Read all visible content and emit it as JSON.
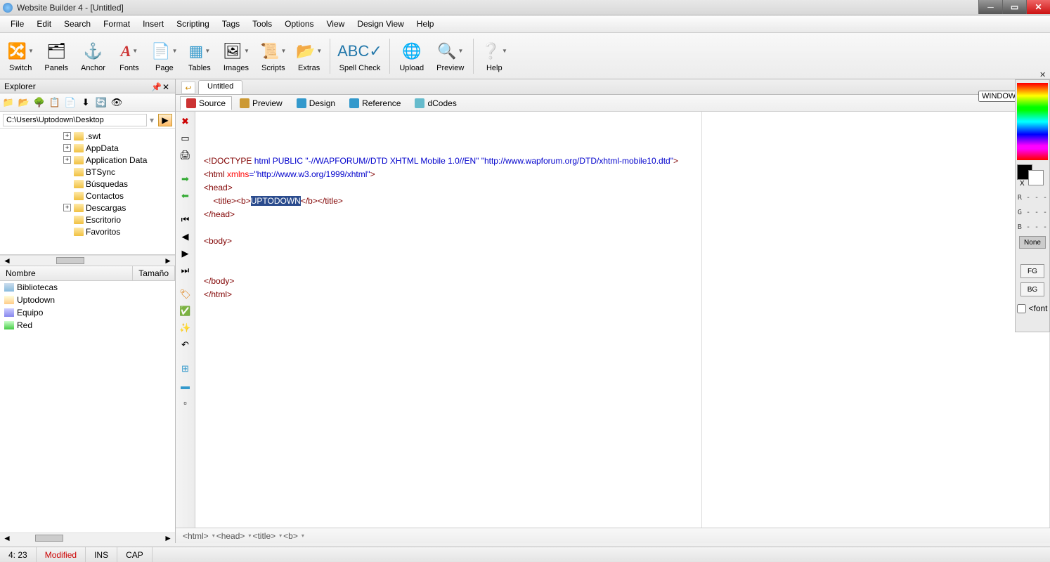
{
  "titlebar": {
    "title": "Website Builder 4 - [Untitled]"
  },
  "menu": {
    "items": [
      "File",
      "Edit",
      "Search",
      "Format",
      "Insert",
      "Scripting",
      "Tags",
      "Tools",
      "Options",
      "View",
      "Design View",
      "Help"
    ]
  },
  "toolbar": {
    "items": [
      {
        "label": "Switch",
        "icon": "🔀",
        "drop": true
      },
      {
        "label": "Panels",
        "icon": "🗂",
        "drop": false
      },
      {
        "label": "Anchor",
        "icon": "⚓",
        "drop": false
      },
      {
        "label": "Fonts",
        "icon": "A",
        "drop": true,
        "color": "#c33"
      },
      {
        "label": "Page",
        "icon": "📄",
        "drop": true
      },
      {
        "label": "Tables",
        "icon": "▦",
        "drop": true,
        "color": "#39c"
      },
      {
        "label": "Images",
        "icon": "🖼",
        "drop": true
      },
      {
        "label": "Scripts",
        "icon": "📜",
        "drop": true,
        "color": "#e90"
      },
      {
        "label": "Extras",
        "icon": "📂",
        "drop": true,
        "color": "#3a3"
      },
      {
        "label": "Spell Check",
        "icon": "ABC✓",
        "color": "#27a"
      },
      {
        "label": "Upload",
        "icon": "🌐",
        "color": "#3a3"
      },
      {
        "label": "Preview",
        "icon": "🔍",
        "drop": true
      },
      {
        "label": "Help",
        "icon": "❔",
        "drop": true,
        "color": "#3a3"
      }
    ]
  },
  "explorer": {
    "title": "Explorer",
    "path": "C:\\Users\\Uptodown\\Desktop",
    "tree": [
      {
        "label": ".swt",
        "exp": true
      },
      {
        "label": "AppData",
        "exp": true
      },
      {
        "label": "Application Data",
        "exp": true
      },
      {
        "label": "BTSync",
        "exp": false
      },
      {
        "label": "Búsquedas",
        "exp": false
      },
      {
        "label": "Contactos",
        "exp": false
      },
      {
        "label": "Descargas",
        "exp": true
      },
      {
        "label": "Escritorio",
        "exp": false
      },
      {
        "label": "Favoritos",
        "exp": false
      }
    ],
    "cols": {
      "name": "Nombre",
      "size": "Tamaño"
    },
    "files": [
      {
        "label": "Bibliotecas",
        "cls": "fic-lib"
      },
      {
        "label": "Uptodown",
        "cls": "fic-user"
      },
      {
        "label": "Equipo",
        "cls": "fic-comp"
      },
      {
        "label": "Red",
        "cls": "fic-net"
      }
    ]
  },
  "doc": {
    "tab": "Untitled",
    "windows_sel": "WINDOWS"
  },
  "viewtabs": [
    {
      "label": "Source",
      "active": true,
      "color": "#c33"
    },
    {
      "label": "Preview",
      "color": "#c93"
    },
    {
      "label": "Design",
      "color": "#39c"
    },
    {
      "label": "Reference",
      "color": "#39c"
    },
    {
      "label": "dCodes",
      "color": "#6bc"
    }
  ],
  "code": {
    "doctype_pre": "<!DOCTYPE ",
    "doctype_kw": "html PUBLIC",
    "doctype_str": " \"-//WAPFORUM//DTD XHTML Mobile 1.0//EN\" \"http://www.wapforum.org/DTD/xhtml-mobile10.dtd\"",
    "doctype_post": ">",
    "html_open_pre": "<html ",
    "html_attr": "xmlns",
    "html_attr_val": "=\"http://www.w3.org/1999/xhtml\"",
    "html_open_post": ">",
    "head_open": "<head>",
    "title_pre": "    <title><b>",
    "title_sel": "UPTODOWN",
    "title_post": "</b></title>",
    "head_close": "</head>",
    "body_open": "<body>",
    "body_close": "</body>",
    "html_close": "</html>"
  },
  "breadcrumb": [
    "<html>",
    "<head>",
    "<title>",
    "<b>"
  ],
  "colorpanel": {
    "r": "R - - -",
    "g": "G - - -",
    "b": "B - - -",
    "none": "None",
    "fg": "FG",
    "bg": "BG",
    "font": "<font"
  },
  "status": {
    "pos": "4: 23",
    "mod": "Modified",
    "ins": "INS",
    "cap": "CAP"
  }
}
